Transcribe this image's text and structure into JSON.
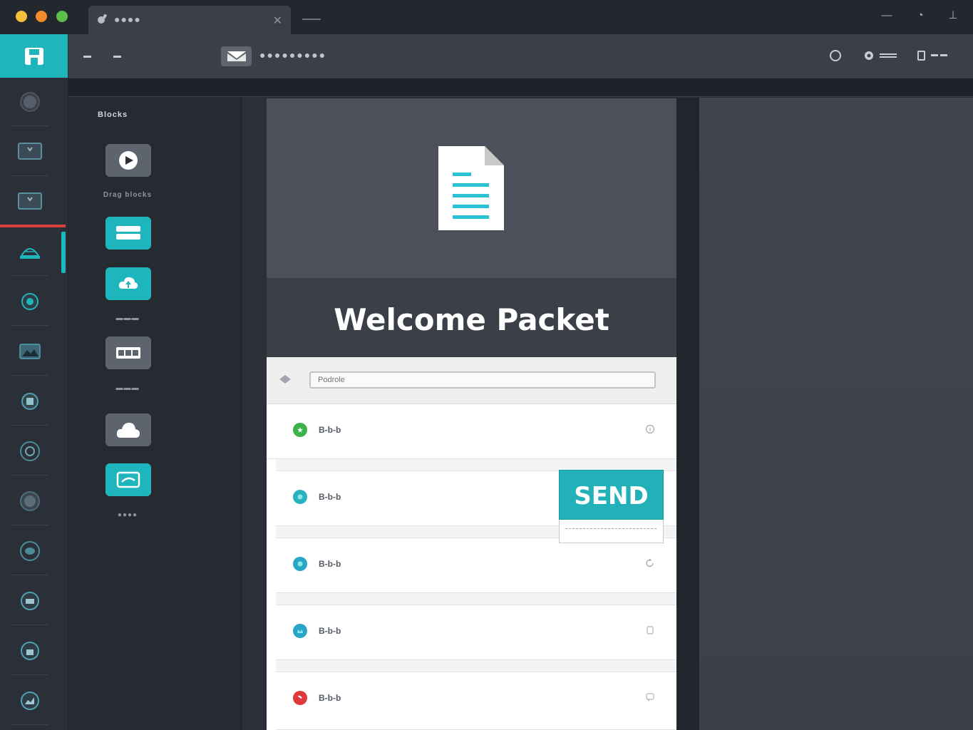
{
  "window": {
    "tab_title": "●●●●",
    "tab_close": "✕",
    "traffic_lights": [
      "#f5c13d",
      "#f38b2c",
      "#5bbf4a"
    ],
    "controls": [
      {
        "icon": "minimize-icon",
        "glyph": "—"
      },
      {
        "icon": "globe-icon",
        "glyph": "◔"
      },
      {
        "icon": "pin-icon",
        "glyph": "⊥"
      }
    ]
  },
  "toolbar": {
    "label": "●●●●●●●●●",
    "accent": "#1fb5bd"
  },
  "palette": {
    "heading": "Blocks",
    "items": [
      {
        "icon": "play-icon",
        "style": "gray",
        "caption": "Drag blocks"
      },
      {
        "icon": "text-block-icon",
        "style": "teal",
        "caption": ""
      },
      {
        "icon": "cloud-upload-icon",
        "style": "teal",
        "caption": "▬▬▬"
      },
      {
        "icon": "video-icon",
        "style": "gray",
        "caption": "▬▬▬"
      },
      {
        "icon": "cloud-icon",
        "style": "gray",
        "caption": ""
      },
      {
        "icon": "image-icon",
        "style": "teal",
        "caption": "●●●●"
      }
    ]
  },
  "document": {
    "title": "Welcome Packet",
    "search_placeholder": "Podrole",
    "send_label": "SEND",
    "rows": [
      {
        "label": "B-b-b",
        "color": "#3cb24a"
      },
      {
        "label": "B-b-b",
        "color": "#27b3c2"
      },
      {
        "label": "B-b-b",
        "color": "#27a6c8"
      },
      {
        "label": "B-b-b",
        "color": "#27a6c8"
      },
      {
        "label": "B-b-b",
        "color": "#e0383b"
      }
    ]
  }
}
